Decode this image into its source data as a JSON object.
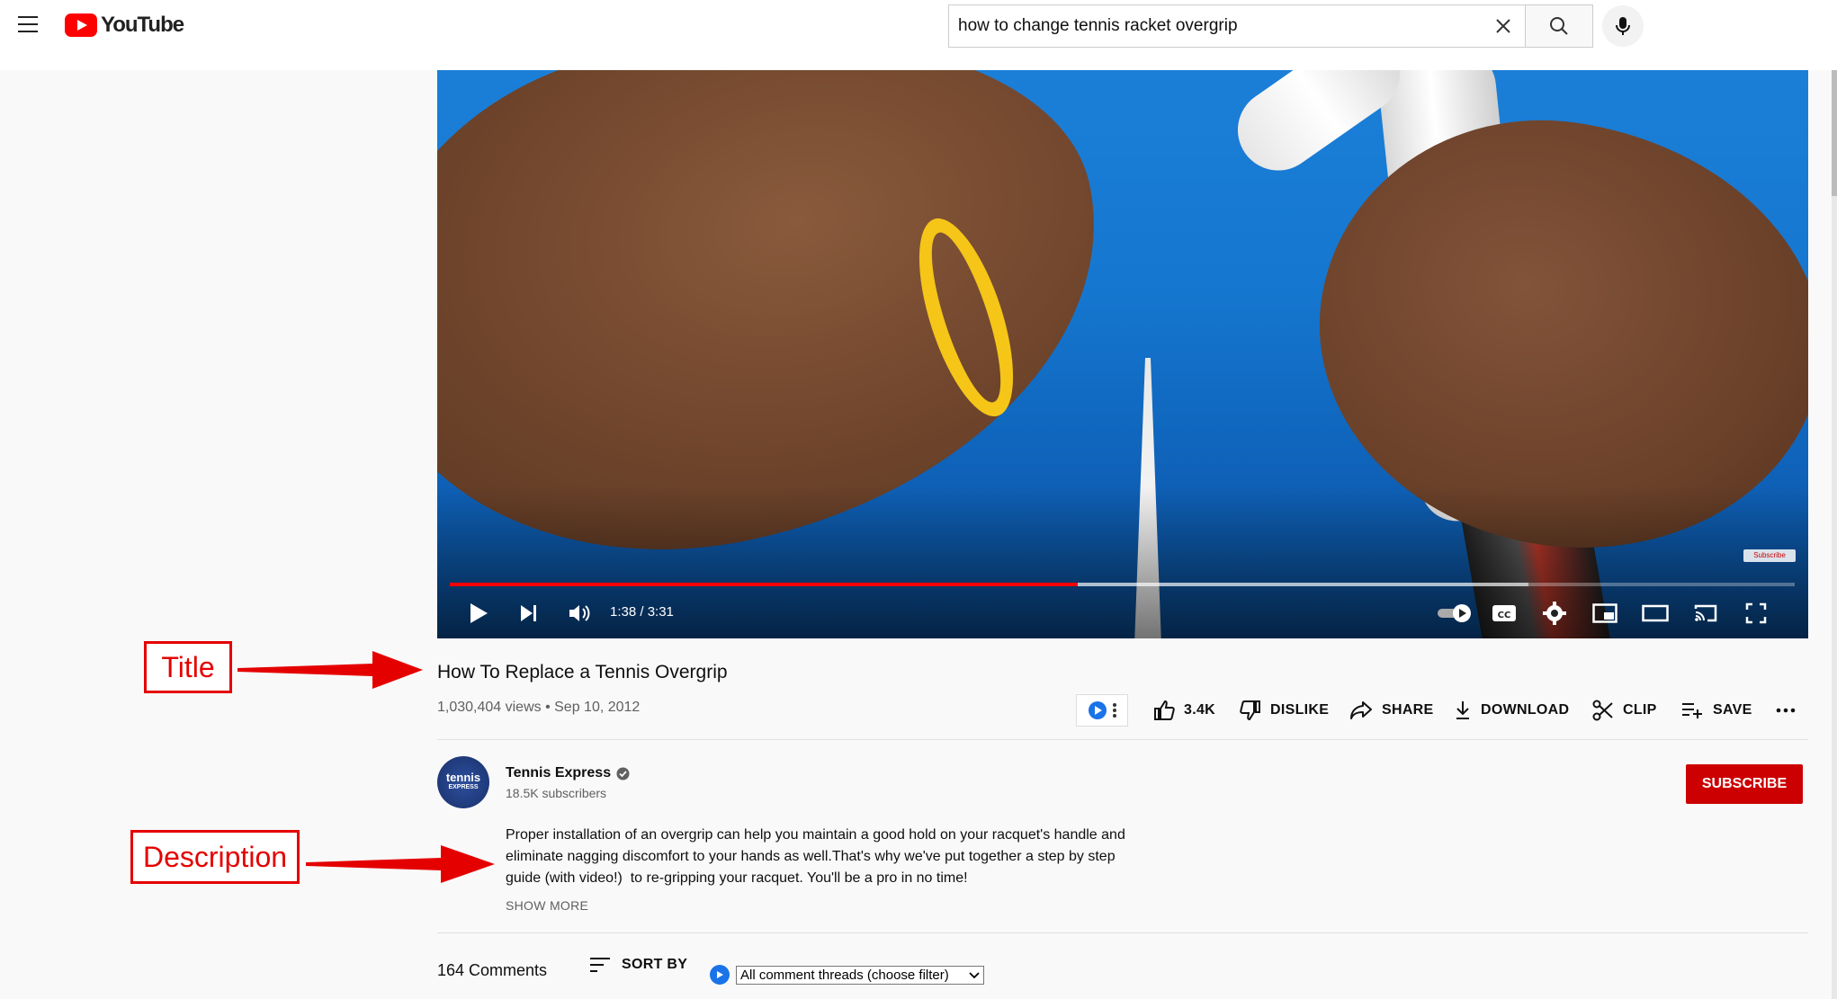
{
  "header": {
    "logo_text": "YouTube",
    "search": {
      "value": "how to change tennis racket overgrip",
      "placeholder": "Search"
    }
  },
  "player": {
    "timecode": "1:38 / 3:31",
    "played_fraction": 0.467,
    "buffered_fraction": 0.802,
    "watermark": "Subscribe"
  },
  "annotations": {
    "title_label": "Title",
    "description_label": "Description",
    "color": "#e50000"
  },
  "video": {
    "title": "How To Replace a Tennis Overgrip",
    "meta": "1,030,404 views • Sep 10, 2012",
    "actions": {
      "like": "3.4K",
      "dislike": "DISLIKE",
      "share": "SHARE",
      "download": "DOWNLOAD",
      "clip": "CLIP",
      "save": "SAVE"
    }
  },
  "channel": {
    "name": "Tennis Express",
    "subscribers": "18.5K subscribers",
    "avatar_text_top": "tennis",
    "avatar_text_bottom": "EXPRESS",
    "subscribe_label": "SUBSCRIBE",
    "subscribe_color": "#cc0000"
  },
  "description": {
    "line1": "Proper installation of an overgrip can help you maintain a good hold on your racquet's handle and",
    "line2": "eliminate nagging discomfort to your hands as well.That's why we've put together a step by step",
    "line3": "guide (with video!)  to re-gripping your racquet. You'll be a pro in no time!",
    "show_more": "SHOW MORE"
  },
  "comments": {
    "count": "164 Comments",
    "sort_label": "SORT BY",
    "filter_value": "All comment threads (choose filter)"
  }
}
